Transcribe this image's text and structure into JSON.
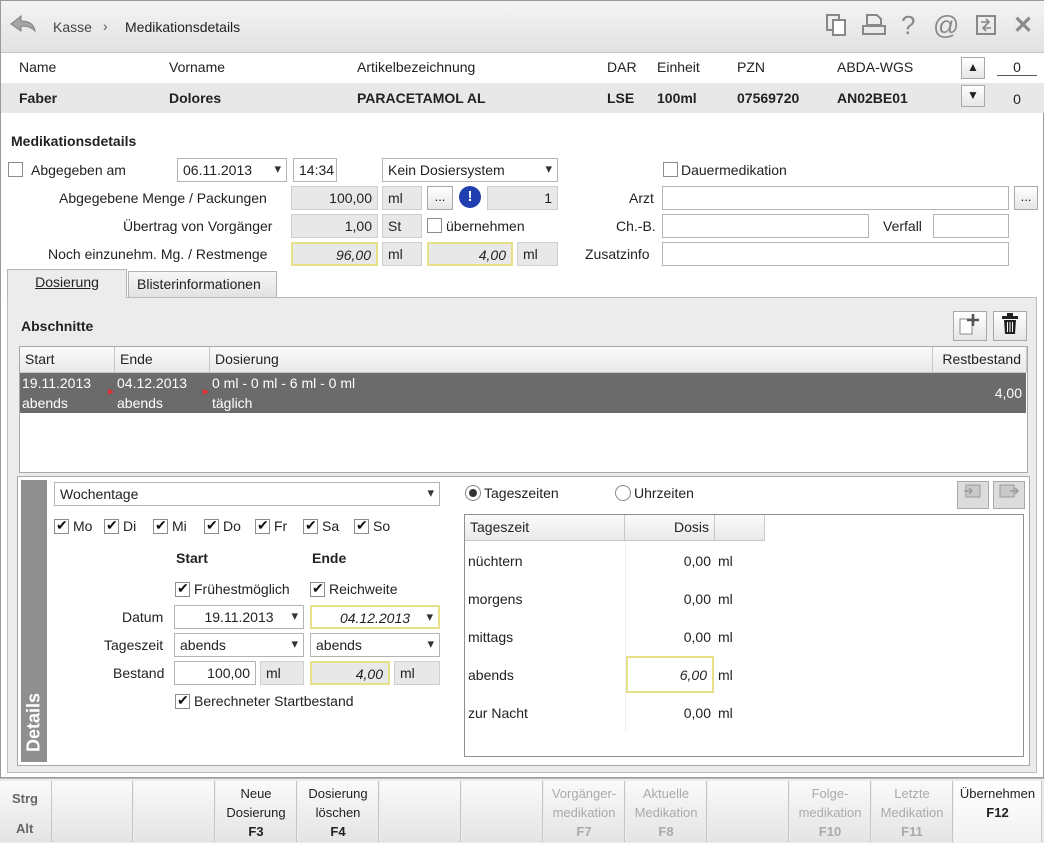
{
  "breadcrumb": {
    "home": "Kasse",
    "sep": "›",
    "current": "Medikationsdetails"
  },
  "header": {
    "columns": [
      "Name",
      "Vorname",
      "Artikelbezeichnung",
      "DAR",
      "Einheit",
      "PZN",
      "ABDA-WGS"
    ],
    "values": [
      "Faber",
      "Dolores",
      "PARACETAMOL AL",
      "LSE",
      "100ml",
      "07569720",
      "AN02BE01"
    ],
    "counter_top": "0",
    "counter_bottom": "0"
  },
  "form": {
    "section_title": "Medikationsdetails",
    "abgegeben_label": "Abgegeben am",
    "date": "06.11.2013",
    "time": "14:34",
    "dosiersystem": "Kein Dosiersystem",
    "dauermedikation_label": "Dauermedikation",
    "menge_label": "Abgegebene Menge / Packungen",
    "menge_value": "100,00",
    "menge_unit": "ml",
    "dots": "...",
    "packungen": "1",
    "arzt_label": "Arzt",
    "uebertrag_label": "Übertrag von Vorgänger",
    "uebertrag_value": "1,00",
    "uebertrag_unit": "St",
    "uebernehmen_label": "übernehmen",
    "chb_label": "Ch.-B.",
    "verfall_label": "Verfall",
    "noch_label": "Noch einzunehm. Mg. / Restmenge",
    "noch_value": "96,00",
    "noch_unit": "ml",
    "rest_value": "4,00",
    "rest_unit": "ml",
    "zusatz_label": "Zusatzinfo"
  },
  "tabs": {
    "dosierung": "Dosierung",
    "blister": "Blisterinformationen"
  },
  "abschnitte": {
    "title": "Abschnitte",
    "columns": [
      "Start",
      "Ende",
      "Dosierung",
      "Restbestand"
    ],
    "row": {
      "start1": "19.11.2013",
      "start2": "abends",
      "ende1": "04.12.2013",
      "ende2": "abends",
      "dos1": "0 ml - 0 ml - 6 ml - 0 ml",
      "dos2": "täglich",
      "rest": "4,00"
    }
  },
  "details": {
    "side_label": "Details",
    "mode": "Wochentage",
    "days": [
      "Mo",
      "Di",
      "Mi",
      "Do",
      "Fr",
      "Sa",
      "So"
    ],
    "start_label": "Start",
    "ende_label": "Ende",
    "fruehest_label": "Frühestmöglich",
    "reichweite_label": "Reichweite",
    "datum_label": "Datum",
    "start_datum": "19.11.2013",
    "ende_datum": "04.12.2013",
    "tageszeit_label": "Tageszeit",
    "start_tz": "abends",
    "ende_tz": "abends",
    "bestand_label": "Bestand",
    "start_bestand": "100,00",
    "start_unit": "ml",
    "ende_bestand": "4,00",
    "ende_unit": "ml",
    "berechnet_label": "Berechneter Startbestand",
    "radio_tageszeiten": "Tageszeiten",
    "radio_uhrzeiten": "Uhrzeiten",
    "dose_headers": [
      "Tageszeit",
      "Dosis"
    ],
    "doses": [
      {
        "name": "nüchtern",
        "value": "0,00",
        "unit": "ml"
      },
      {
        "name": "morgens",
        "value": "0,00",
        "unit": "ml"
      },
      {
        "name": "mittags",
        "value": "0,00",
        "unit": "ml"
      },
      {
        "name": "abends",
        "value": "6,00",
        "unit": "ml"
      },
      {
        "name": "zur Nacht",
        "value": "0,00",
        "unit": "ml"
      }
    ]
  },
  "footer": {
    "strg": "Strg",
    "alt": "Alt",
    "keys": [
      {
        "l1": "",
        "l2": "",
        "k": ""
      },
      {
        "l1": "",
        "l2": "",
        "k": ""
      },
      {
        "l1": "Neue",
        "l2": "Dosierung",
        "k": "F3"
      },
      {
        "l1": "Dosierung",
        "l2": "löschen",
        "k": "F4"
      },
      {
        "l1": "",
        "l2": "",
        "k": ""
      },
      {
        "l1": "",
        "l2": "",
        "k": ""
      },
      {
        "l1": "Vorgänger-",
        "l2": "medikation",
        "k": "F7"
      },
      {
        "l1": "Aktuelle",
        "l2": "Medikation",
        "k": "F8"
      },
      {
        "l1": "",
        "l2": "",
        "k": ""
      },
      {
        "l1": "Folge-",
        "l2": "medikation",
        "k": "F10"
      },
      {
        "l1": "Letzte",
        "l2": "Medikation",
        "k": "F11"
      },
      {
        "l1": "Übernehmen",
        "l2": "",
        "k": "F12"
      }
    ]
  }
}
